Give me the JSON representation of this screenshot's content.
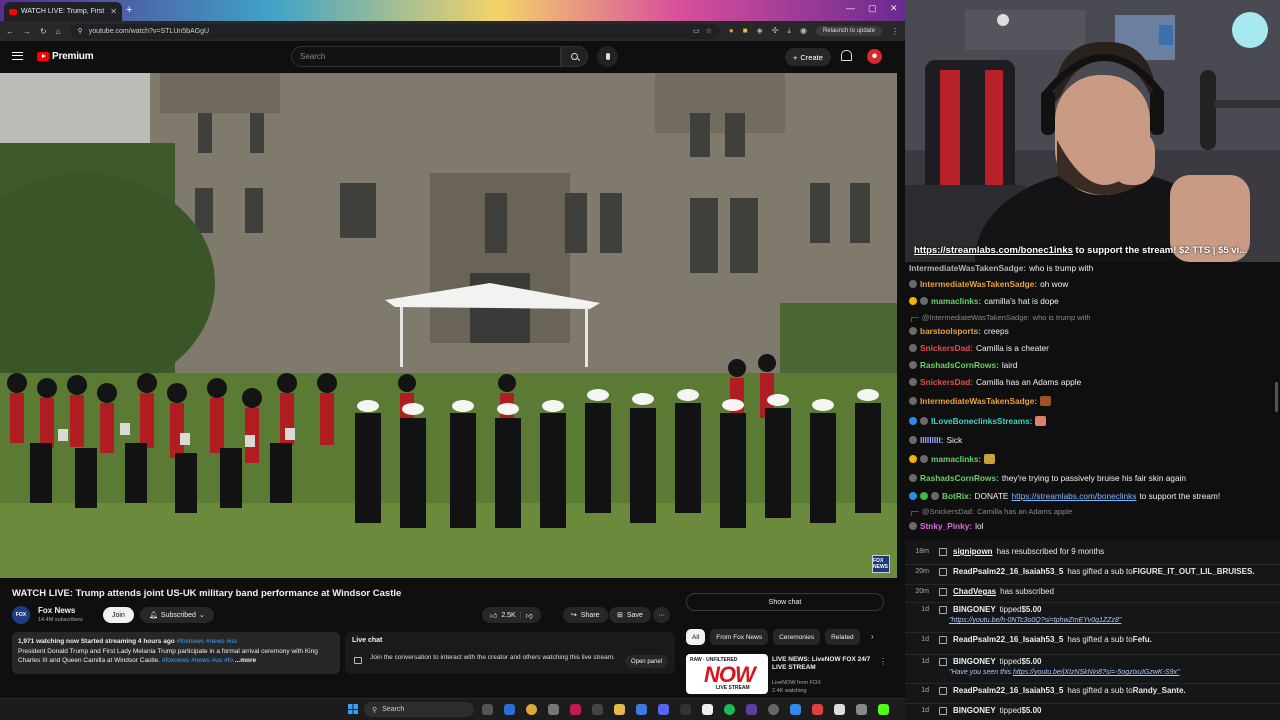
{
  "browser": {
    "tab_title": "WATCH LIVE: Trump, First La",
    "url": "youtube.com/watch?v=STLUn5bAGgU",
    "relaunch_label": "Relaunch to update"
  },
  "header": {
    "logo_text": "Premium",
    "search_placeholder": "Search",
    "create_label": "Create"
  },
  "video": {
    "channel_bug": "FOX NEWS",
    "title": "WATCH LIVE: Trump attends joint US-UK military band performance at Windsor Castle",
    "channel_name": "Fox News",
    "channel_initials": "FOX",
    "subscribers": "14.4M subscribers",
    "join_label": "Join",
    "subscribed_label": "Subscribed",
    "likes": "2.5K",
    "share_label": "Share",
    "save_label": "Save",
    "more_label": "···"
  },
  "description": {
    "stats": "1,971 watching now  Started streaming 4 hours ago",
    "tags": "#foxnews #news #us",
    "text": "President Donald Trump and First Lady Melania Trump participate in a formal arrival ceremony with King Charles III and Queen Camilla at Windsor Castle.",
    "tags2": "#foxnews #news #us #fo",
    "more": "...more"
  },
  "live_chat": {
    "title": "Live chat",
    "text": "Join the conversation to interact with the creator and others watching this live stream.",
    "open_panel": "Open panel",
    "show_chat": "Show chat"
  },
  "chips": [
    "All",
    "From Fox News",
    "Ceremonies",
    "Related"
  ],
  "recommendation": {
    "thumb_top": "RAW · UNFILTERED",
    "thumb_main": "NOW",
    "thumb_sub": "LIVE STREAM",
    "title": "LIVE NEWS: LiveNOW FOX 24/7 LIVE STREAM",
    "channel": "LiveNOW from FOX",
    "watching": "2.4K watching"
  },
  "taskbar": {
    "search_label": "Search"
  },
  "overlay_url": {
    "link": "https://streamlabs.com/bonec1inks",
    "rest": " to support the stream! $2 TTS | $5 vi..."
  },
  "chat": [
    {
      "kind": "cut",
      "user": "IntermediateWasTakenSadge:",
      "text": " who is trump with",
      "color": "#b3b3b3"
    },
    {
      "kind": "msg",
      "user": "IntermediateWasTakenSadge:",
      "text": " oh wow",
      "color": "#e8a33a"
    },
    {
      "kind": "msg",
      "user": "mamaclinks:",
      "text": " camilla's hat is dope",
      "color": "#6ad06a",
      "badges": [
        "yellow"
      ]
    },
    {
      "kind": "reply",
      "user": "@IntermediateWasTakenSadge:",
      "text": " who is trump with"
    },
    {
      "kind": "msg",
      "user": "barstoolsports:",
      "text": " creeps",
      "color": "#e8a33a"
    },
    {
      "kind": "msg",
      "user": "SnickersDad:",
      "text": " Camilla is a cheater",
      "color": "#e84a4a"
    },
    {
      "kind": "msg",
      "user": "RashadsCornRows:",
      "text": " laird",
      "color": "#6ad06a"
    },
    {
      "kind": "msg",
      "user": "SnickersDad:",
      "text": " Camilla has an Adams apple",
      "color": "#e84a4a"
    },
    {
      "kind": "msg",
      "user": "IntermediateWasTakenSadge:",
      "text": "",
      "color": "#e8a33a",
      "emote": "#a0522d"
    },
    {
      "kind": "msg",
      "user": "ILoveBoneclinksStreams:",
      "text": "",
      "color": "#3fd3c7",
      "badges": [
        "blue"
      ],
      "emote": "#d9826b"
    },
    {
      "kind": "msg",
      "user": "IIIIIIIII:",
      "text": " Sick",
      "color": "#9fa7ff"
    },
    {
      "kind": "msg",
      "user": "mamaclinks:",
      "text": "",
      "color": "#6ad06a",
      "badges": [
        "yellow"
      ],
      "emote": "#c9a03a"
    },
    {
      "kind": "msg",
      "user": "RashadsCornRows:",
      "text": " they're trying to passively bruise his fair skin again",
      "color": "#6ad06a"
    },
    {
      "kind": "msg",
      "user": "BotRix:",
      "text": " DONATE ",
      "link": "https://streamlabs.com/boneclinks",
      "after": " to support the stream!",
      "color": "#6ad06a",
      "badges": [
        "blue",
        "green"
      ]
    },
    {
      "kind": "reply",
      "user": "@SnickersDad:",
      "text": " Camilla has an Adams apple"
    },
    {
      "kind": "msg",
      "user": "Stnky_Pinky:",
      "text": " lol",
      "color": "#e06ae0"
    }
  ],
  "feed": [
    {
      "time": "18m",
      "user": "signipown",
      "underline": true,
      "text": " has resubscribed for 9 months"
    },
    {
      "time": "20m",
      "user": "ReadPsalm22_16_Isaiah53_5",
      "text": " has gifted a sub to ",
      "bold_tail": "FIGURE_IT_OUT_LIL_BRUISES."
    },
    {
      "time": "20m",
      "user": "ChadVegas",
      "underline": true,
      "text": " has subscribed"
    },
    {
      "time": "1d",
      "user": "BINGONEY",
      "text": " tipped ",
      "bold_tail": "$5.00",
      "sub": "\"https://youtu.be/h-0NTc3o0Q?si=tphwZmEYv0q1ZZz8\""
    },
    {
      "time": "1d",
      "user": "ReadPsalm22_16_Isaiah53_5",
      "text": " has gifted a sub to ",
      "bold_tail": "Fefu."
    },
    {
      "time": "1d",
      "user": "BINGONEY",
      "text": " tipped ",
      "bold_tail": "$5.00",
      "sub_pre": "\"Have you seen this ",
      "sub": "https://youtu.be/jXIzNSkNin8?si=-5ogzIxuIGzwK-S9x\""
    },
    {
      "time": "1d",
      "user": "ReadPsalm22_16_Isaiah53_5",
      "text": " has gifted a sub to ",
      "bold_tail": "Randy_Sante."
    },
    {
      "time": "1d",
      "user": "BINGONEY",
      "text": " tipped ",
      "bold_tail": "$5.00"
    }
  ],
  "colors": {
    "accent_red": "#ff0000",
    "link_blue": "#3ea6ff",
    "bg": "#0f0f0f"
  }
}
